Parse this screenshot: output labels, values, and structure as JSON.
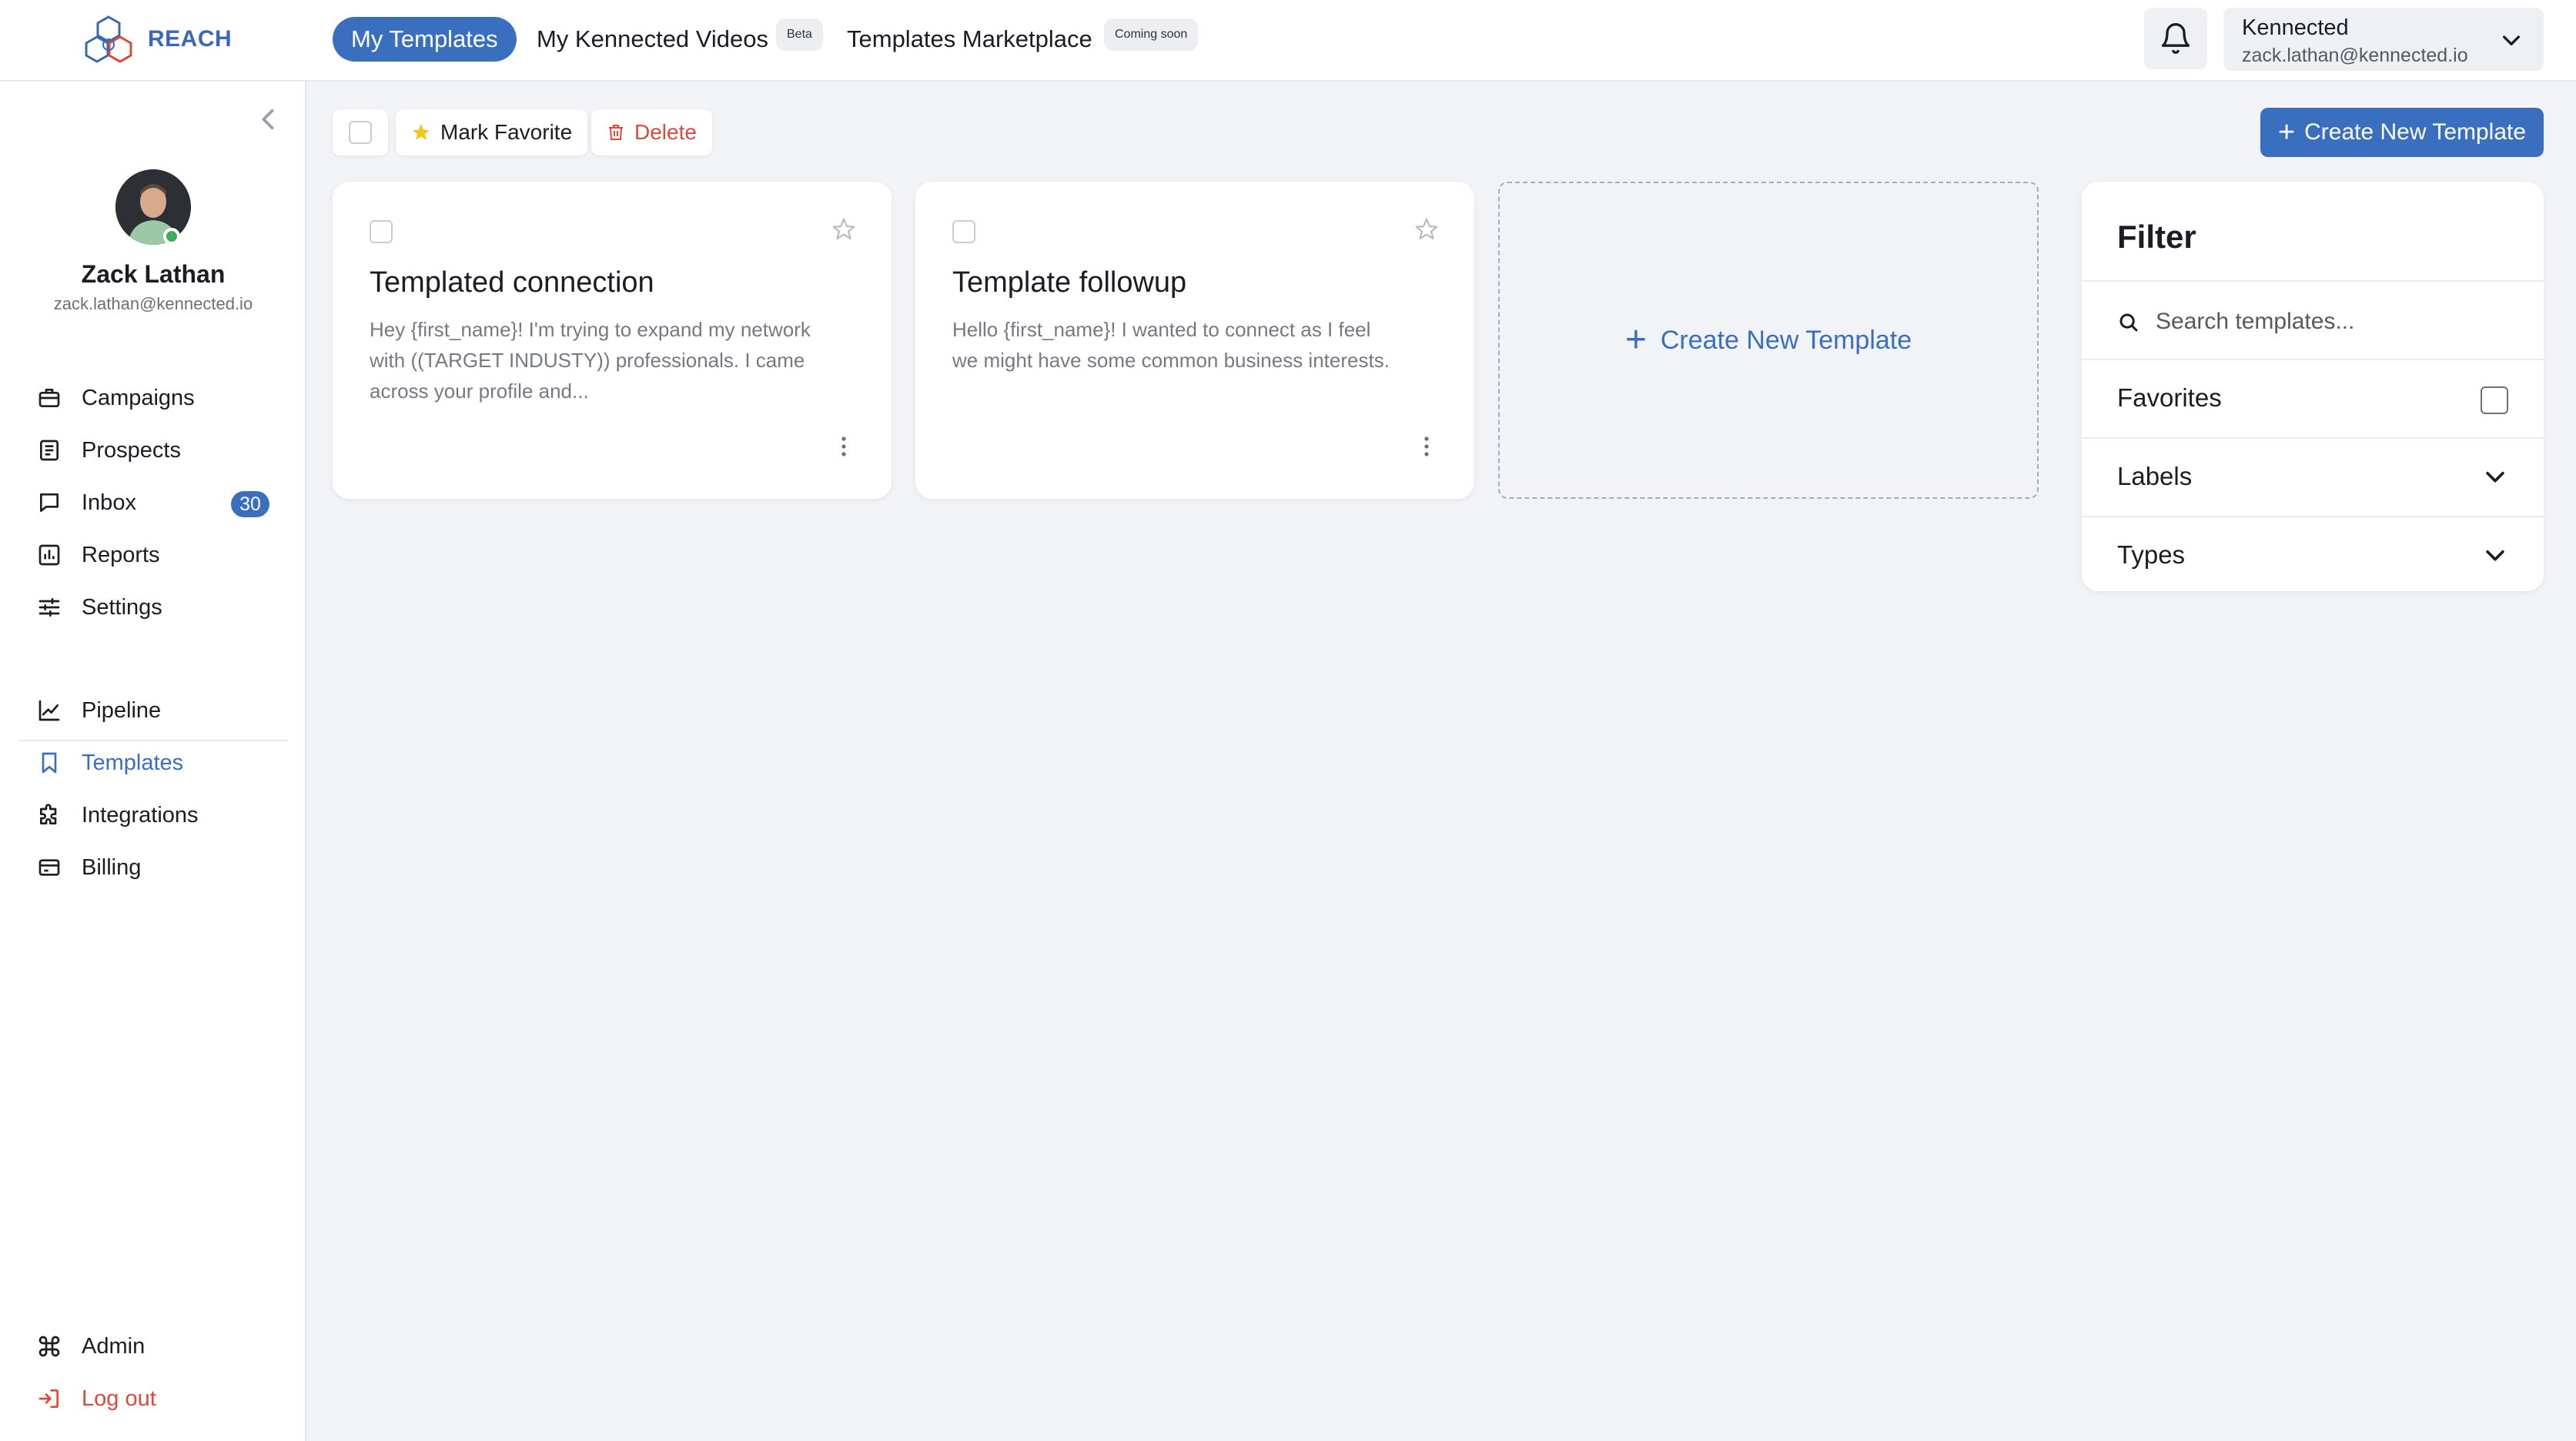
{
  "brand": {
    "name": "REACH",
    "logo_icon": "hexagon-logo-icon"
  },
  "top_tabs": [
    {
      "label": "My Templates",
      "active": true
    },
    {
      "label": "My Kennected Videos",
      "badge": "Beta"
    },
    {
      "label": "Templates Marketplace",
      "badge": "Coming soon"
    }
  ],
  "account": {
    "org": "Kennected",
    "email": "zack.lathan@kennected.io"
  },
  "user": {
    "name": "Zack Lathan",
    "email": "zack.lathan@kennected.io",
    "status": "online"
  },
  "nav": {
    "primary": [
      {
        "label": "Campaigns",
        "icon": "briefcase-icon"
      },
      {
        "label": "Prospects",
        "icon": "document-list-icon"
      },
      {
        "label": "Inbox",
        "icon": "chat-icon",
        "badge": "30"
      },
      {
        "label": "Reports",
        "icon": "bar-chart-icon"
      },
      {
        "label": "Settings",
        "icon": "sliders-icon"
      }
    ],
    "secondary": [
      {
        "label": "Pipeline",
        "icon": "line-chart-icon"
      },
      {
        "label": "Templates",
        "icon": "bookmark-icon",
        "active": true
      },
      {
        "label": "Integrations",
        "icon": "puzzle-icon"
      },
      {
        "label": "Billing",
        "icon": "card-icon"
      }
    ],
    "bottom": [
      {
        "label": "Admin",
        "icon": "command-icon"
      },
      {
        "label": "Log out",
        "icon": "logout-icon"
      }
    ]
  },
  "toolbar": {
    "mark_favorite": "Mark Favorite",
    "delete": "Delete",
    "create": "Create New Template"
  },
  "templates": [
    {
      "title": "Templated connection",
      "preview": "Hey {first_name}! I'm trying to expand my network with ((TARGET INDUSTY)) professionals. I came across your profile and..."
    },
    {
      "title": "Template followup",
      "preview": "Hello {first_name}! I wanted to connect as I feel we might have some common business interests."
    }
  ],
  "new_template_card": {
    "label": "Create New Template"
  },
  "filter": {
    "title": "Filter",
    "search_placeholder": "Search templates...",
    "favorites_label": "Favorites",
    "labels_label": "Labels",
    "types_label": "Types"
  },
  "colors": {
    "primary": "#3a6fc0",
    "danger": "#d94a3c",
    "background": "#f2f3f6",
    "online": "#3fae5a"
  }
}
